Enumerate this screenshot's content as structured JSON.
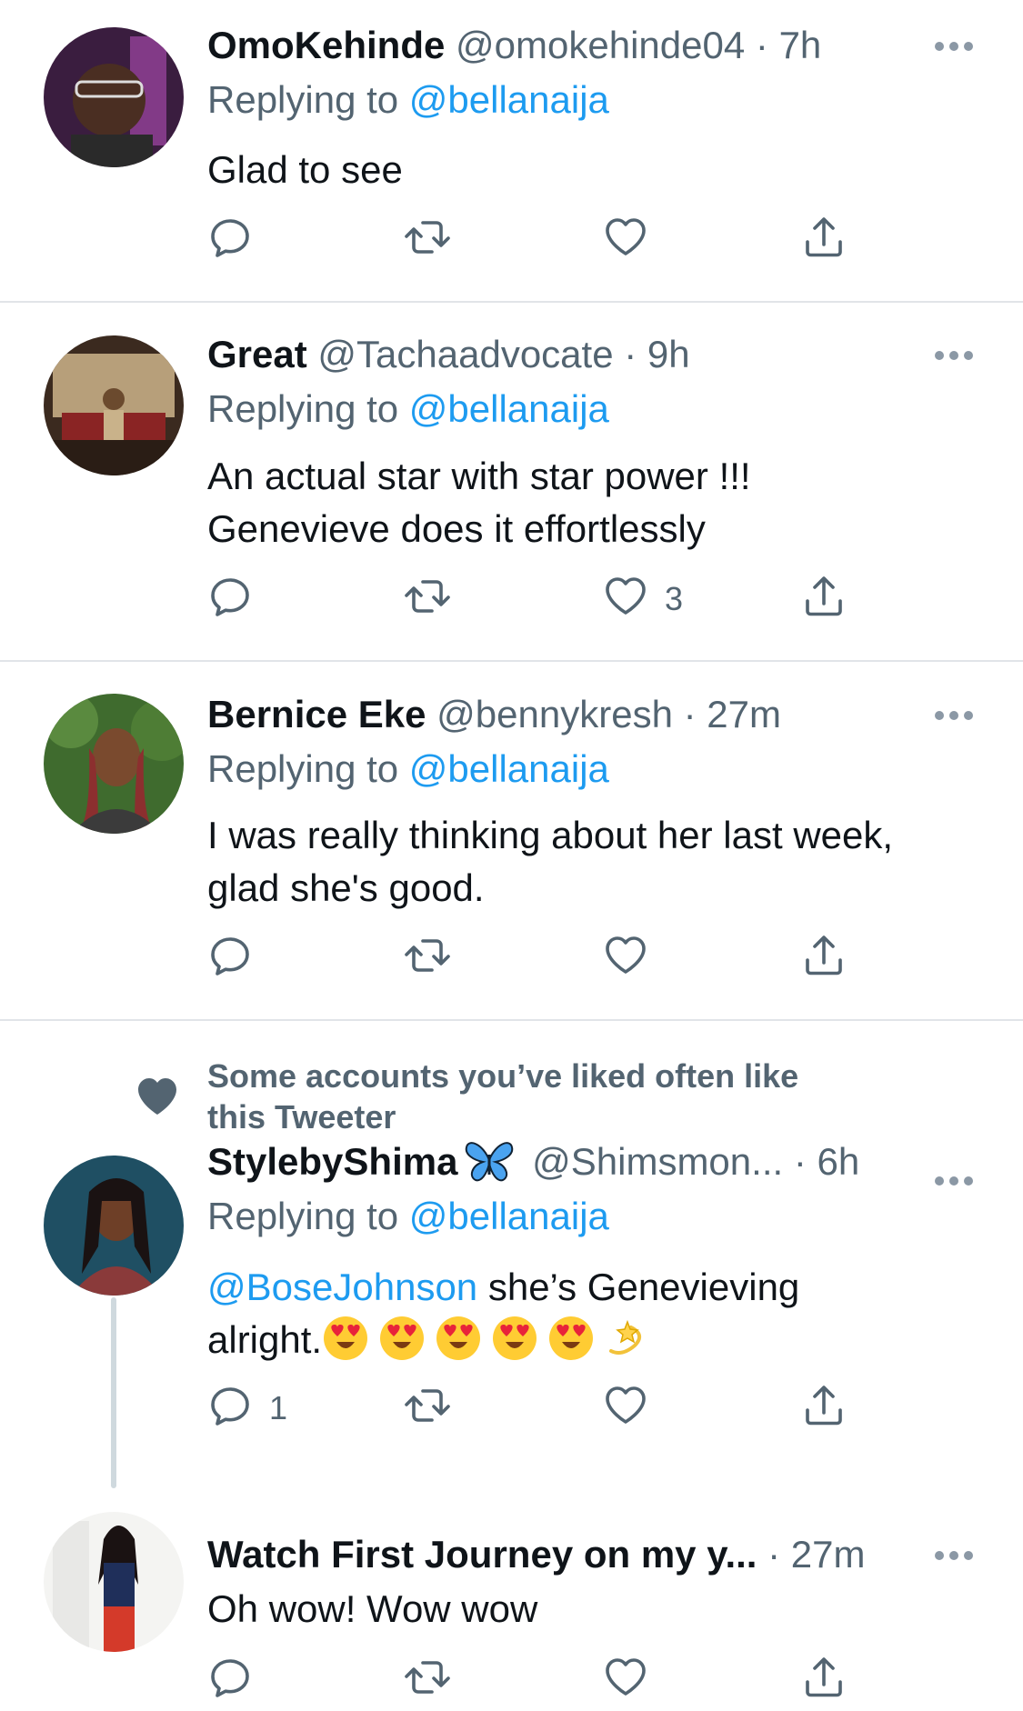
{
  "colors": {
    "link": "#1d9bf0",
    "secondary": "#536471",
    "text": "#0f1419",
    "divider": "#e1e4e8"
  },
  "tweets": [
    {
      "name": "OmoKehinde",
      "handle": "@omokehinde04",
      "dot": "·",
      "time": "7h",
      "replying_prefix": "Replying to ",
      "replying_to": "@bellanaija",
      "text": "Glad to see",
      "likes": ""
    },
    {
      "name": "Great",
      "handle": "@Tachaadvocate",
      "dot": "·",
      "time": "9h",
      "replying_prefix": "Replying to ",
      "replying_to": "@bellanaija",
      "text_line1": "An actual star with star power !!!",
      "text_line2": "Genevieve does it effortlessly",
      "likes": "3"
    },
    {
      "name": "Bernice Eke",
      "handle": "@bennykresh",
      "dot": "·",
      "time": "27m",
      "replying_prefix": "Replying to ",
      "replying_to": "@bellanaija",
      "text_line1": "I was really thinking about her last week,",
      "text_line2": "glad she's good.",
      "likes": ""
    },
    {
      "social_context_line1": "Some accounts you’ve liked often like",
      "social_context_line2": "this Tweeter",
      "name": "StylebyShima",
      "name_icon": "butterfly-emoji",
      "handle": "@Shimsmon...",
      "dot": "·",
      "time": "6h",
      "replying_prefix": "Replying to ",
      "replying_to": "@bellanaija",
      "text_mention": "@BoseJohnson",
      "text_line1_rest": " she’s Genevieving",
      "text_line2": "alright.",
      "emojis": [
        "heart-eyes-emoji",
        "heart-eyes-emoji",
        "heart-eyes-emoji",
        "heart-eyes-emoji",
        "heart-eyes-emoji",
        "dizzy-emoji"
      ],
      "replies": "1"
    },
    {
      "name": "Watch First Journey on my y...",
      "dot": "·",
      "time": "27m",
      "text": "Oh wow! Wow wow"
    }
  ]
}
